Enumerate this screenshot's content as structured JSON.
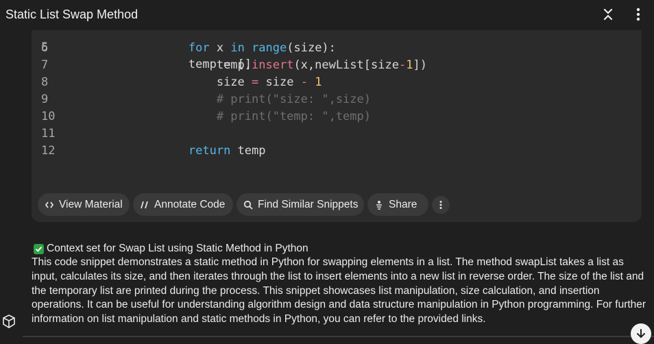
{
  "window": {
    "title": "Static List Swap Method"
  },
  "code": {
    "partial_line": "temp = []",
    "lines": [
      {
        "num": "6",
        "parts": [
          [
            "indent",
            "        "
          ],
          [
            "kw",
            "for"
          ],
          [
            "t",
            " x "
          ],
          [
            "kw",
            "in"
          ],
          [
            "t",
            " "
          ],
          [
            "fn",
            "range"
          ],
          [
            "t",
            "(size):"
          ]
        ]
      },
      {
        "num": "7",
        "parts": [
          [
            "indent",
            "            "
          ],
          [
            "t",
            "temp."
          ],
          [
            "pk",
            "insert"
          ],
          [
            "t",
            "(x,newList[size"
          ],
          [
            "op",
            "-"
          ],
          [
            "num",
            "1"
          ],
          [
            "t",
            "])"
          ]
        ]
      },
      {
        "num": "8",
        "parts": [
          [
            "indent",
            "            "
          ],
          [
            "t",
            "size "
          ],
          [
            "op",
            "="
          ],
          [
            "t",
            " size "
          ],
          [
            "op",
            "-"
          ],
          [
            "t",
            " "
          ],
          [
            "num",
            "1"
          ]
        ]
      },
      {
        "num": "9",
        "parts": [
          [
            "indent",
            "            "
          ],
          [
            "cm",
            "# print(\"size: \",size)"
          ]
        ]
      },
      {
        "num": "10",
        "parts": [
          [
            "indent",
            "            "
          ],
          [
            "cm",
            "# print(\"temp: \",temp)"
          ]
        ]
      },
      {
        "num": "11",
        "parts": []
      },
      {
        "num": "12",
        "parts": [
          [
            "indent",
            "        "
          ],
          [
            "kw",
            "return"
          ],
          [
            "t",
            " temp"
          ]
        ]
      }
    ]
  },
  "actions": {
    "view_material": "View Material",
    "annotate_code": "Annotate Code",
    "find_similar": "Find Similar Snippets",
    "share": "Share"
  },
  "summary": {
    "context_text": "Context set for Swap List using Static Method in Python",
    "description": "This code snippet demonstrates a static method in Python for swapping elements in a list. The method swapList takes a list as input, calculates its size, and then iterates through the list to insert elements into a new list in reverse order. The size of the list and the temporary list are printed during the process. This snippet showcases list manipulation, size calculation, and insertion operations. It can be useful for understanding algorithm design and data structure manipulation in Python programming. For further information on list manipulation and static methods in Python, you can refer to the provided links."
  },
  "icons": {
    "collapse": "collapse-icon",
    "more": "more-vertical-icon",
    "check": "checkmark-icon",
    "scroll_down": "arrow-down-icon",
    "assistant": "cube-icon"
  },
  "colors": {
    "background": "#1f1f1f",
    "code_card": "#2b2b2b",
    "button_bg": "#3a3a3a",
    "keyword": "#56b6e6",
    "method": "#e6758b",
    "number": "#f0c674",
    "comment": "#6f6f6f",
    "check": "#2ea043"
  }
}
